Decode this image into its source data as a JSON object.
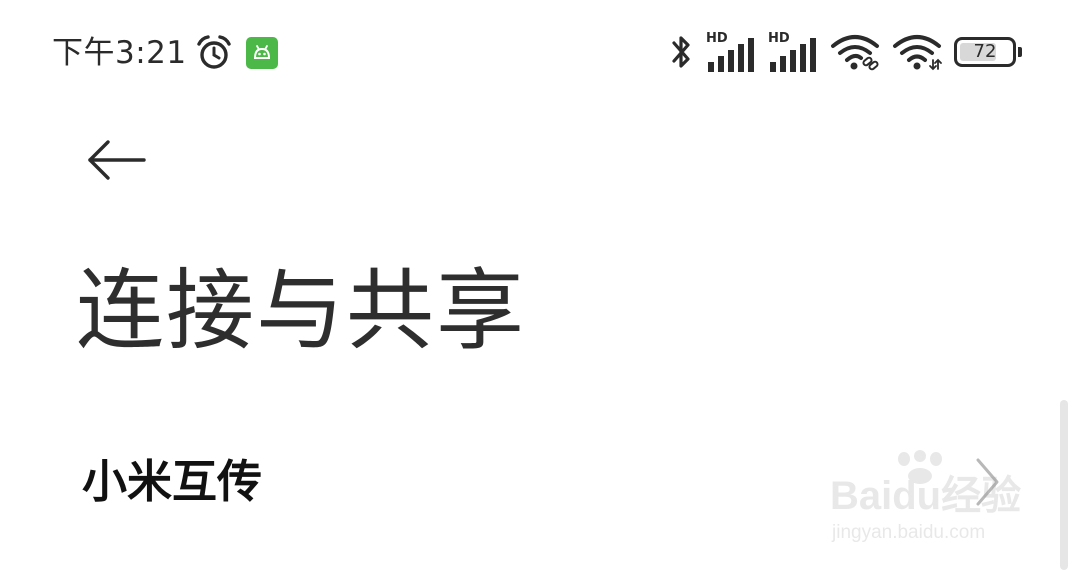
{
  "status_bar": {
    "time": "下午3:21",
    "icons": {
      "alarm": "alarm-clock-icon",
      "app_notification": "android-app-icon",
      "bluetooth": "bluetooth-icon",
      "signal": "cellular-signal-icon",
      "wifi_linked": "wifi-link-icon",
      "wifi": "wifi-icon"
    },
    "signal_1_label": "HD",
    "signal_2_label": "HD",
    "battery_level": "72",
    "battery_fraction": 0.72
  },
  "header": {
    "back_icon": "arrow-left-icon",
    "title": "连接与共享"
  },
  "list": {
    "items": [
      {
        "label": "小米互传",
        "icon": "chevron-right-icon"
      }
    ]
  },
  "watermark": {
    "brand": "Baidu经验",
    "url": "jingyan.baidu.com"
  },
  "colors": {
    "background": "#ffffff",
    "text_primary": "#111111",
    "title_text": "#2e2e2e",
    "status_text": "#2b2b2b",
    "app_icon_green": "#4cb848",
    "chevron": "#b8b8b8",
    "scrollbar": "#e6e6e6"
  }
}
